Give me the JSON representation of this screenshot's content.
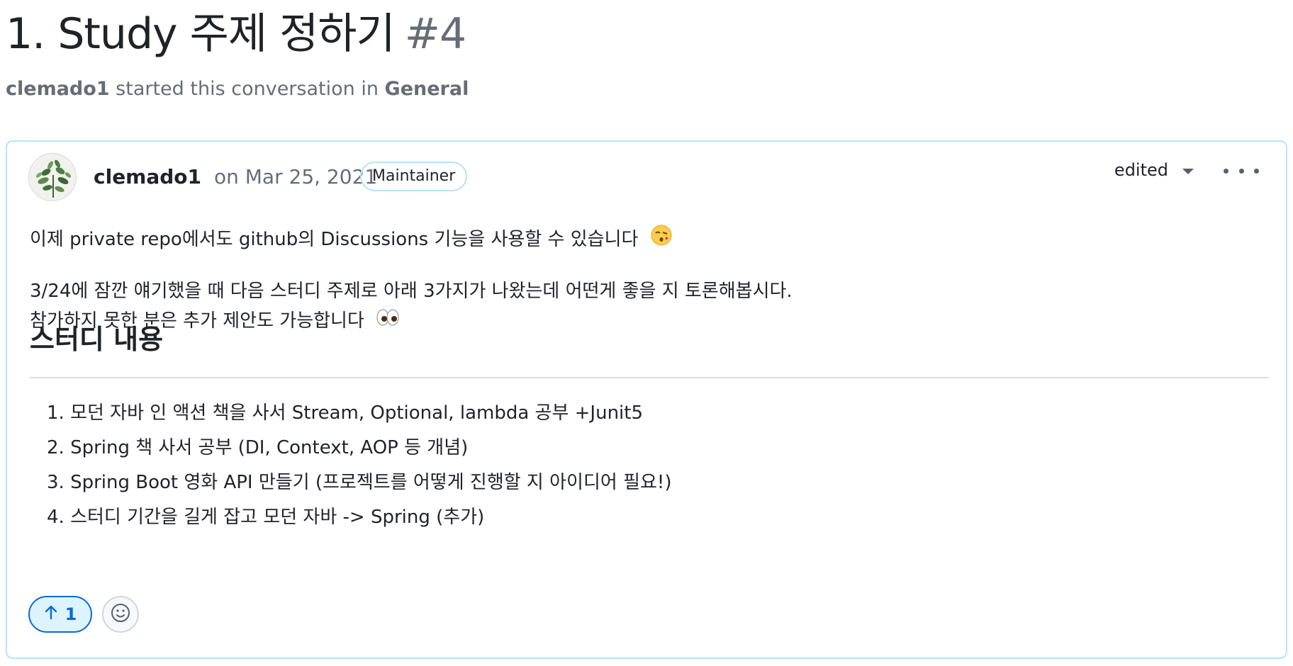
{
  "page": {
    "title": "1. Study 주제 정하기",
    "number": "#4",
    "subtitle": {
      "author": "clemado1",
      "middle": " started this conversation in ",
      "category": "General"
    }
  },
  "post": {
    "author": "clemado1",
    "date": "on Mar 25, 2021",
    "badge": "Maintainer",
    "edited_label": "edited",
    "paragraph1": "이제 private repo에서도 github의 Discussions 기능을 사용할 수 있습니다",
    "paragraph2_line1": "3/24에 잠깐 얘기했을 때 다음 스터디 주제로 아래 3가지가 나왔는데 어떤게 좋을 지 토론해봅시다.",
    "paragraph2_line2": "참가하지 못한 분은 추가 제안도 가능합니다",
    "section_heading": "스터디 내용",
    "list": [
      "1. 모던 자바 인 액션 책을 사서 Stream, Optional, lambda 공부 +Junit5",
      "2. Spring 책 사서 공부 (DI, Context, AOP 등 개념)",
      "3. Spring Boot 영화 API 만들기 (프로젝트를 어떻게 진행할 지 아이디어 필요!)",
      "4. 스터디 기간을 길게 잡고 모던 자바 -> Spring (추가)"
    ],
    "upvote_count": "1"
  },
  "icons": {
    "avatar": "plant-avatar",
    "edited_dropdown": "caret-down-icon",
    "more": "kebab-horizontal-icon",
    "upvote": "arrow-up-icon",
    "reaction": "smiley-icon",
    "emoji1": "kissing-face-emoji",
    "emoji2": "eyes-emoji"
  },
  "colors": {
    "accent": "#0969da",
    "card_border": "#b6e3ff",
    "muted_text": "#656d76"
  }
}
